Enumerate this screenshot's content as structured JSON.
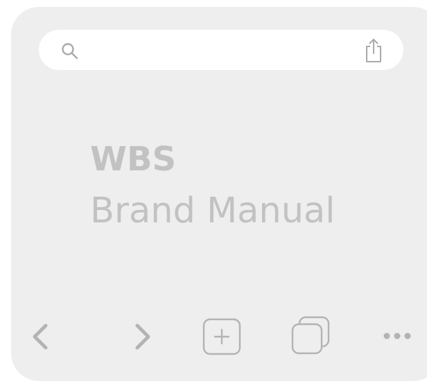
{
  "address_bar": {
    "search_icon": "search-icon",
    "share_icon": "share-icon"
  },
  "content": {
    "title": "WBS",
    "subtitle": "Brand Manual"
  },
  "toolbar": {
    "icons": [
      "chevron-left-icon",
      "chevron-right-icon",
      "plus-square-icon",
      "tabs-icon",
      "more-icon"
    ]
  },
  "colors": {
    "frame": "#eeeeee",
    "address_bar": "#ffffff",
    "icon": "#b8b8b8",
    "text": "#c2c2c2"
  }
}
